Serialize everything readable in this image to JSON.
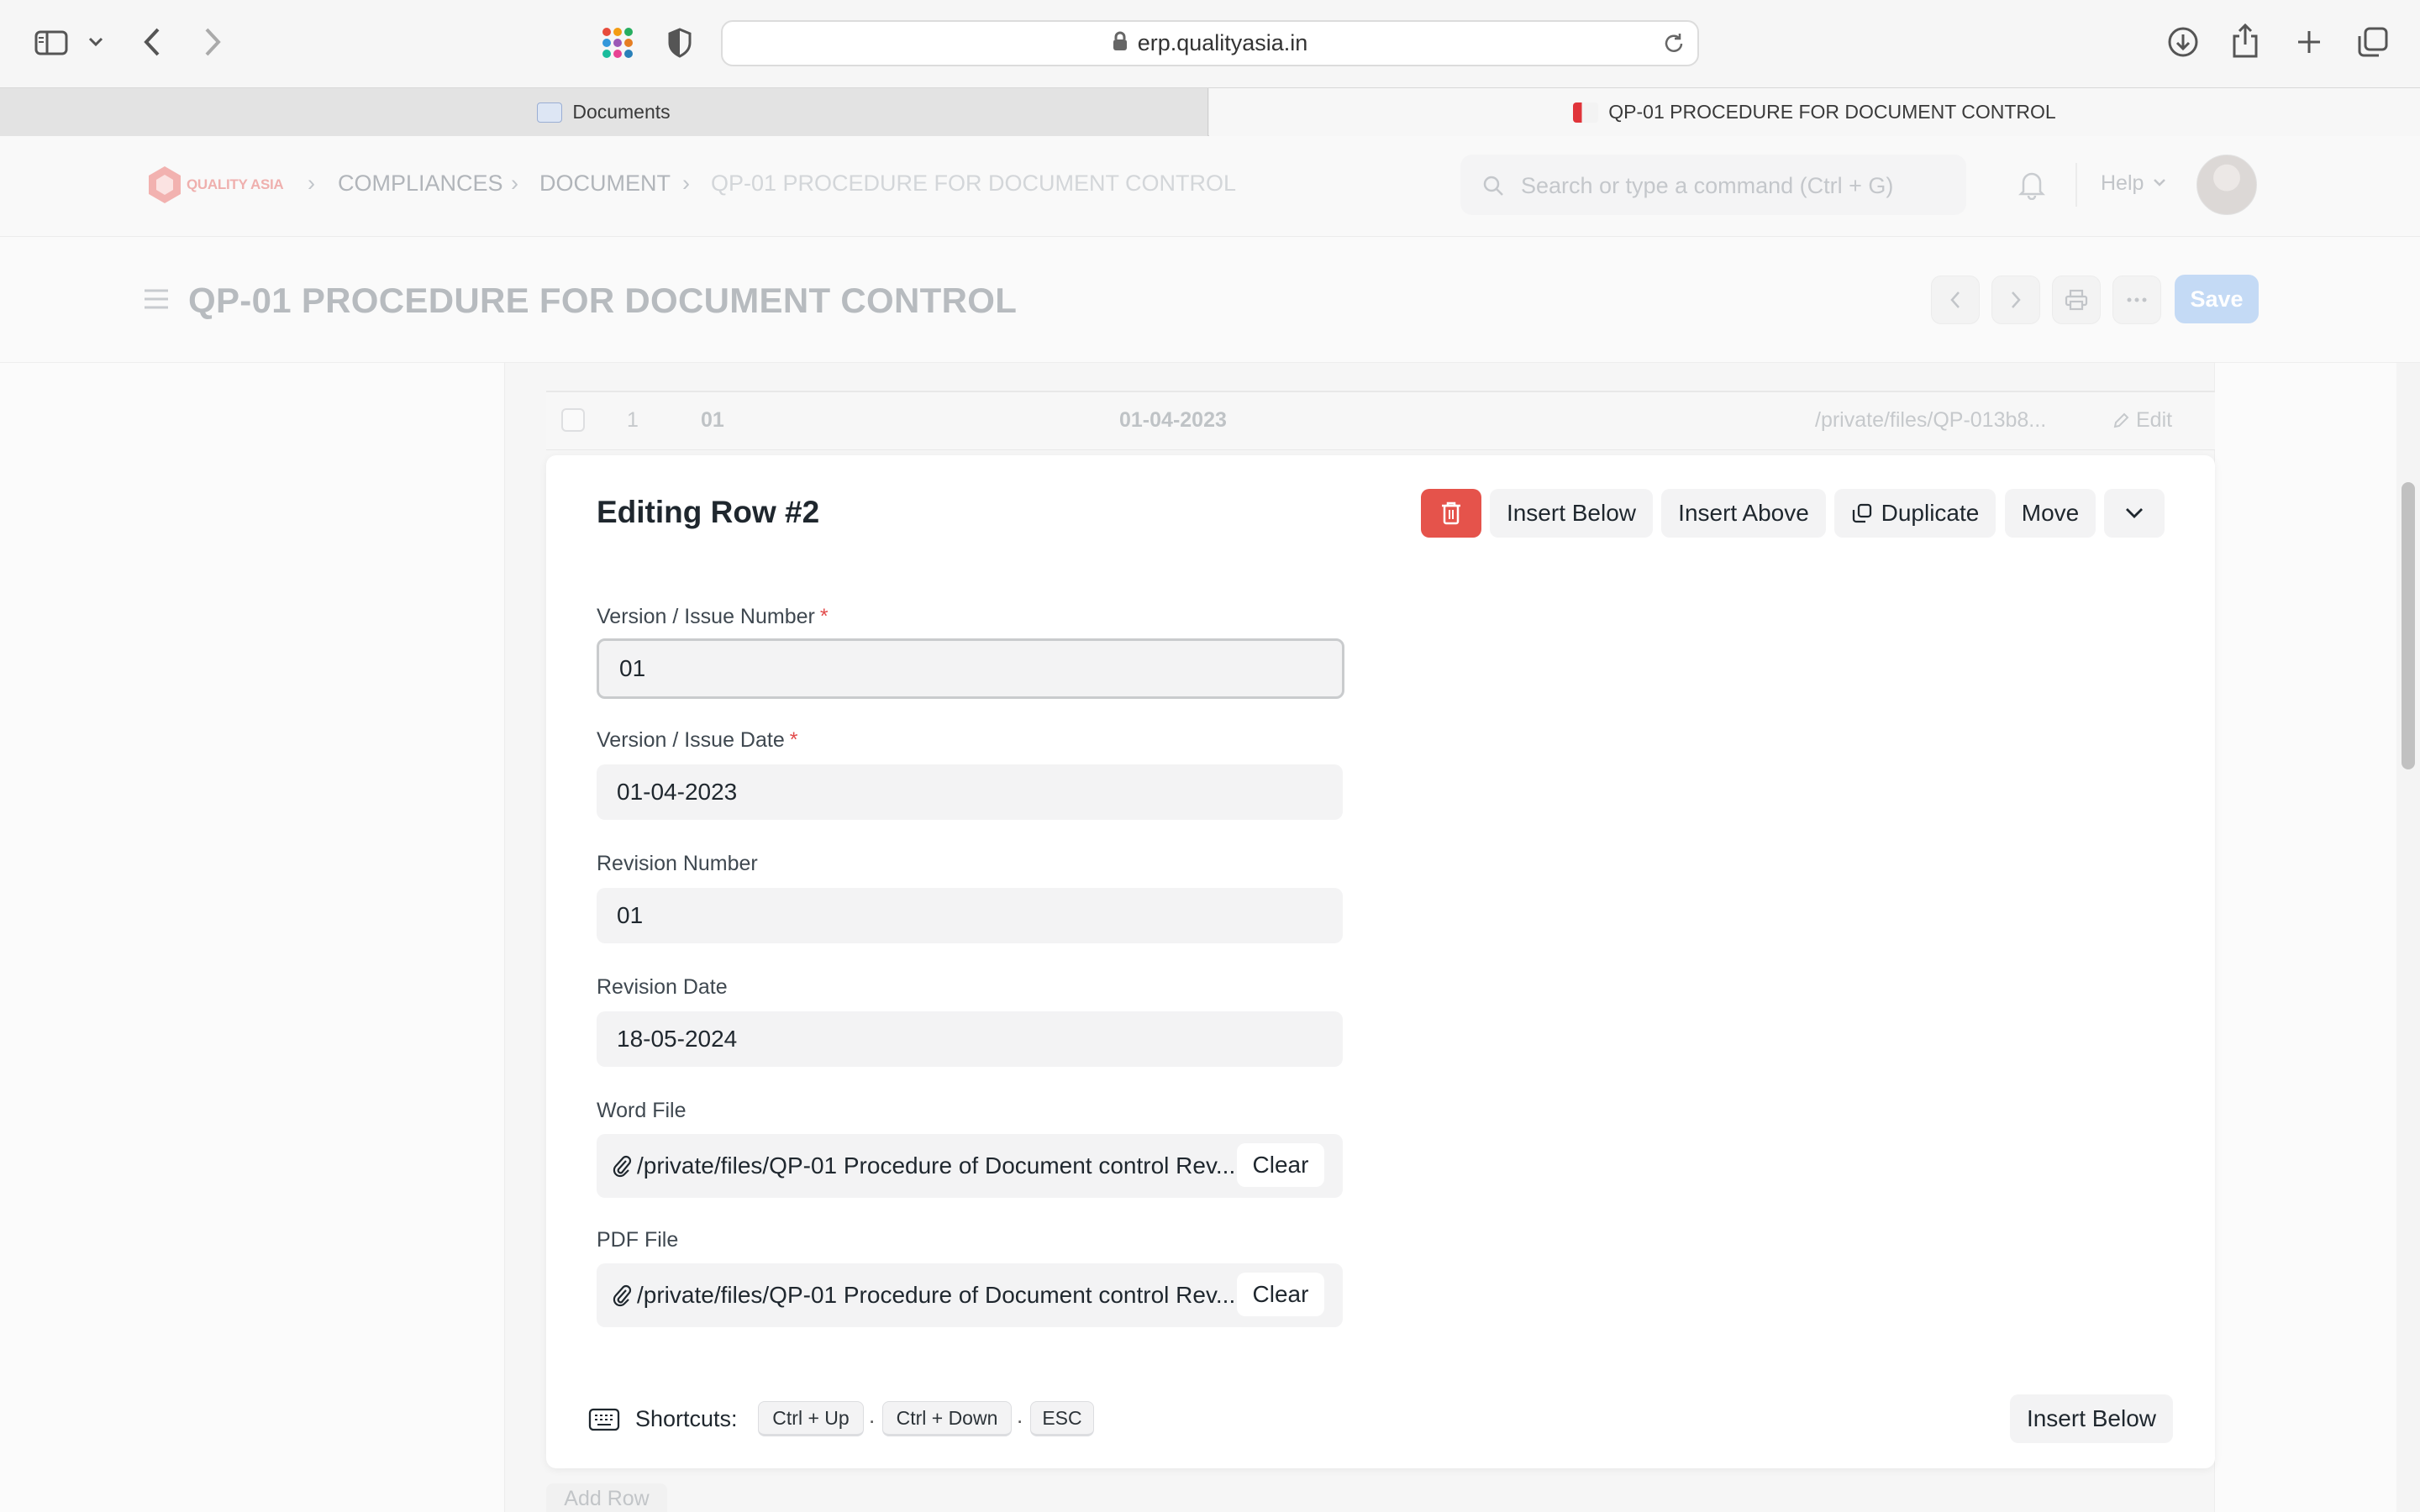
{
  "browser": {
    "url": "erp.qualityasia.in",
    "tabs": [
      {
        "title": "Documents",
        "active": false
      },
      {
        "title": "QP-01 PROCEDURE FOR DOCUMENT CONTROL",
        "active": true
      }
    ]
  },
  "navbar": {
    "logo_text": "QUALITY ASIA",
    "breadcrumbs": [
      "COMPLIANCES",
      "DOCUMENT",
      "QP-01 PROCEDURE FOR DOCUMENT CONTROL"
    ],
    "search_placeholder": "Search or type a command (Ctrl + G)",
    "help_label": "Help"
  },
  "page": {
    "title": "QP-01 PROCEDURE FOR DOCUMENT CONTROL",
    "save_label": "Save"
  },
  "table_row": {
    "index": "1",
    "version": "01",
    "date": "01-04-2023",
    "file": "/private/files/QP-013b8...",
    "edit_label": "Edit"
  },
  "editor": {
    "title": "Editing Row #2",
    "buttons": {
      "insert_below": "Insert Below",
      "insert_above": "Insert Above",
      "duplicate": "Duplicate",
      "move": "Move"
    },
    "fields": {
      "version_number": {
        "label": "Version / Issue Number",
        "value": "01",
        "required": true
      },
      "version_date": {
        "label": "Version / Issue Date",
        "value": "01-04-2023",
        "required": true
      },
      "revision_number": {
        "label": "Revision Number",
        "value": "01"
      },
      "revision_date": {
        "label": "Revision Date",
        "value": "18-05-2024"
      },
      "word_file": {
        "label": "Word File",
        "value": "/private/files/QP-01 Procedure of Document control Rev....",
        "clear_label": "Clear"
      },
      "pdf_file": {
        "label": "PDF File",
        "value": "/private/files/QP-01 Procedure of Document control Rev....",
        "clear_label": "Clear"
      }
    },
    "required_mark": "*",
    "shortcuts": {
      "label": "Shortcuts:",
      "keys": [
        "Ctrl + Up",
        "Ctrl + Down",
        "ESC"
      ],
      "separator": "."
    },
    "insert_below_bottom": "Insert Below"
  },
  "add_row_label": "Add Row",
  "colors": {
    "primary_disabled": "#c4daf5",
    "danger": "#e5534b",
    "required": "#e24c4c"
  }
}
